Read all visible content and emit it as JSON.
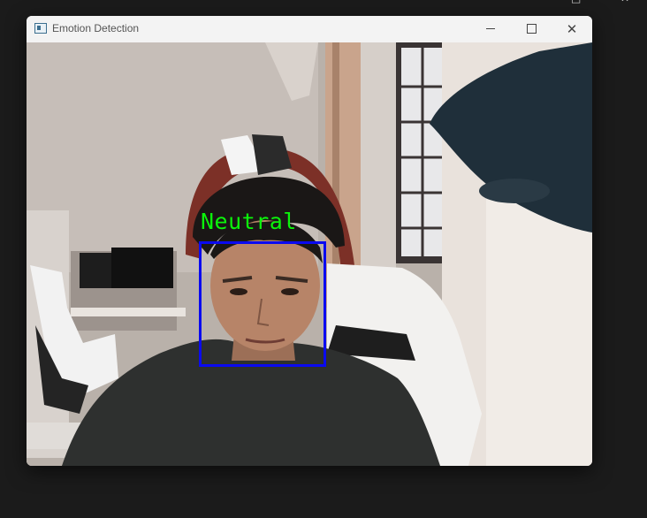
{
  "window": {
    "title": "Emotion Detection",
    "controls": {
      "minimize": "minimize-icon",
      "maximize": "maximize-icon",
      "close": "close-icon"
    }
  },
  "detection": {
    "label": "Neutral",
    "label_color": "#0bf40b",
    "box_color": "#0a0af0"
  },
  "screen_edge_glyphs": [
    "□",
    "✕"
  ]
}
